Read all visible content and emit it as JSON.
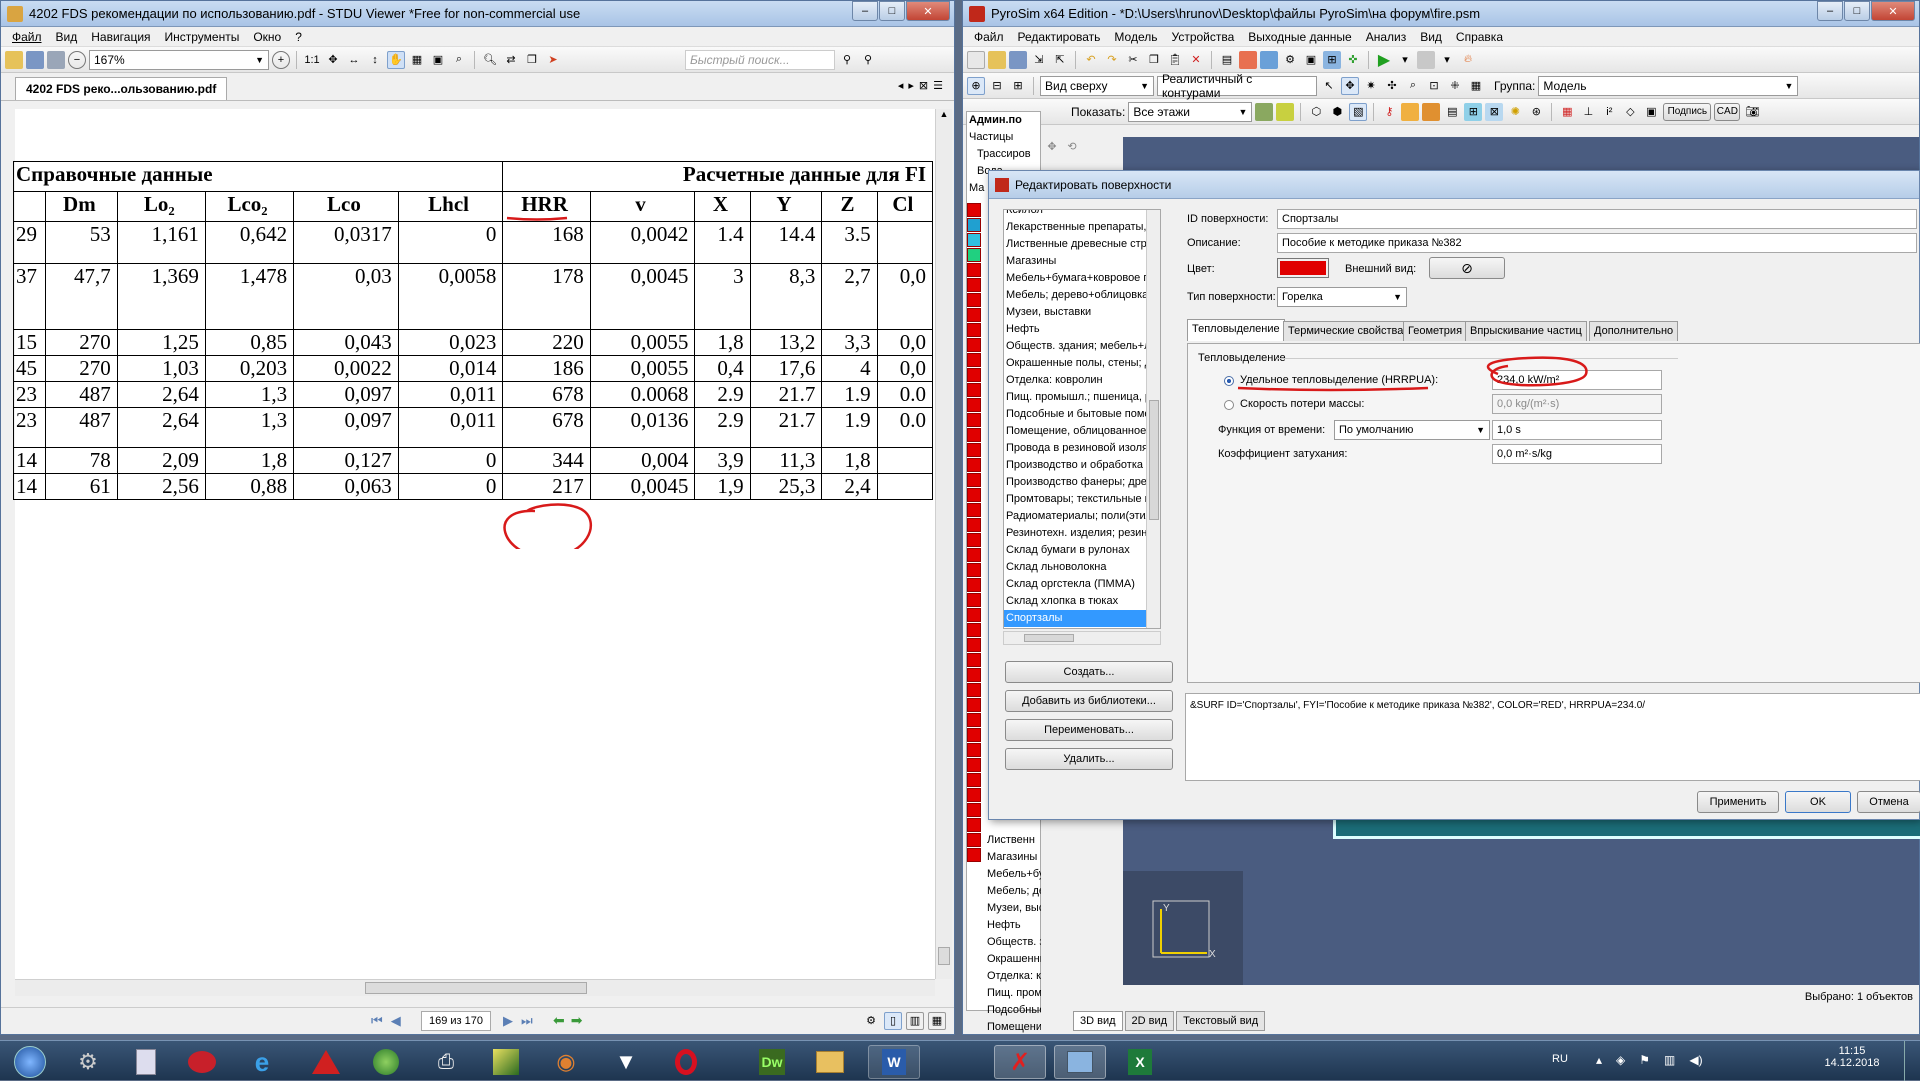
{
  "pdf": {
    "title": "4202 FDS рекомендации по использованию.pdf - STDU Viewer *Free for non-commercial use",
    "menu": [
      "Файл",
      "Вид",
      "Навигация",
      "Инструменты",
      "Окно",
      "?"
    ],
    "zoom": "167%",
    "search_placeholder": "Быстрый поиск...",
    "tab": "4202 FDS реко...ользованию.pdf",
    "page_indicator": "169 из 170",
    "table": {
      "header_left": "Справочные данные",
      "header_right": "Расчетные данные для FI",
      "columns": [
        "Dm",
        "Lo₂",
        "Lco₂",
        "Lco",
        "Lhcl",
        "HRR",
        "v",
        "X",
        "Y",
        "Z",
        "Cl"
      ],
      "rows": [
        [
          "29",
          "53",
          "1,161",
          "0,642",
          "0,0317",
          "0",
          "168",
          "0,0042",
          "1.4",
          "14.4",
          "3.5",
          ""
        ],
        [
          "37",
          "47,7",
          "1,369",
          "1,478",
          "0,03",
          "0,0058",
          "178",
          "0,0045",
          "3",
          "8,3",
          "2,7",
          "0,0"
        ],
        [
          "15",
          "270",
          "1,25",
          "0,85",
          "0,043",
          "0,023",
          "220",
          "0,0055",
          "1,8",
          "13,2",
          "3,3",
          "0,0"
        ],
        [
          "45",
          "270",
          "1,03",
          "0,203",
          "0,0022",
          "0,014",
          "186",
          "0,0055",
          "0,4",
          "17,6",
          "4",
          "0,0"
        ],
        [
          "23",
          "487",
          "2,64",
          "1,3",
          "0,097",
          "0,011",
          "678",
          "0.0068",
          "2.9",
          "21.7",
          "1.9",
          "0.0"
        ],
        [
          "23",
          "487",
          "2,64",
          "1,3",
          "0,097",
          "0,011",
          "678",
          "0,0136",
          "2.9",
          "21.7",
          "1.9",
          "0.0"
        ],
        [
          "14",
          "78",
          "2,09",
          "1,8",
          "0,127",
          "0",
          "344",
          "0,004",
          "3,9",
          "11,3",
          "1,8",
          ""
        ],
        [
          "14",
          "61",
          "2,56",
          "0,88",
          "0,063",
          "0",
          "217",
          "0,0045",
          "1,9",
          "25,3",
          "2,4",
          ""
        ]
      ]
    }
  },
  "pyro": {
    "title": "PyroSim x64 Edition - *D:\\Users\\hrunov\\Desktop\\файлы PyroSim\\на форум\\fire.psm",
    "menu": [
      "Файл",
      "Редактировать",
      "Модель",
      "Устройства",
      "Выходные данные",
      "Анализ",
      "Вид",
      "Справка"
    ],
    "view_combo": "Вид сверху",
    "render_combo": "Реалистичный с контурами",
    "group_label": "Группа:",
    "group_value": "Модель",
    "show_label": "Показать:",
    "show_value": "Все этажи",
    "btn_sign": "Подпись",
    "btn_cad": "CAD",
    "tree": [
      "Админ.по",
      "Частицы",
      "Трассиров",
      "Вода",
      "Ма"
    ],
    "lower_list": [
      "Лиственн",
      "Магазины",
      "Мебель+бу",
      "Мебель; де",
      "Музеи, выс",
      "Нефть",
      "Обществ. з",
      "Окрашенны",
      "Отделка: к",
      "Пищ. проми",
      "Подсобные",
      "Помещени"
    ],
    "bottom_tabs": [
      "3D вид",
      "2D вид",
      "Текстовый вид"
    ],
    "status": "Выбрано: 1 объектов"
  },
  "dialog": {
    "title": "Редактировать поверхности",
    "list": [
      "Ксилол",
      "Лекарственные препараты, с",
      "Лиственные древесные стро",
      "Магазины",
      "Мебель+бумага+ковровое по",
      "Мебель; дерево+облицовка",
      "Музеи, выставки",
      "Нефть",
      "Обществ. здания; мебель+ли",
      "Окрашенные полы, стены; де",
      "Отделка: ковролин",
      "Пищ. промышл.; пшеница, рис",
      "Подсобные и бытовые помещ",
      "Помещение, облицованное па",
      "Провода в резиновой изоляц",
      "Производство и обработка др",
      "Производство фанеры; древе",
      "Промтовары; текстильные из",
      "Радиоматериалы; поли(этиле",
      "Резинотехн. изделия; резина,",
      "Склад бумаги в рулонах",
      "Склад льноволокна",
      "Склад оргстекла (ПММА)",
      "Склад хлопка в тюках",
      "Спортзалы"
    ],
    "selected": "Спортзалы",
    "id_label": "ID поверхности:",
    "id_value": "Спортзалы",
    "desc_label": "Описание:",
    "desc_value": "Пособие к методике приказа №382",
    "color_label": "Цвет:",
    "color_value": "#e00000",
    "appearance_label": "Внешний вид:",
    "type_label": "Тип поверхности:",
    "type_value": "Горелка",
    "tabs": [
      "Тепловыделение",
      "Термические свойства",
      "Геометрия",
      "Впрыскивание частиц",
      "Дополнительно"
    ],
    "group_title": "Тепловыделение",
    "hrrpua_label": "Удельное тепловыделение (HRRPUA):",
    "hrrpua_value": "234,0 kW/m²",
    "mlr_label": "Скорость потери массы:",
    "mlr_value": "0,0 kg/(m²·s)",
    "ramp_label": "Функция от времени:",
    "ramp_value": "По умолчанию",
    "ramp_time": "1,0 s",
    "ext_label": "Коэффициент затухания:",
    "ext_value": "0,0 m²·s/kg",
    "fds_text": "&SURF ID='Спортзалы', FYI='Пособие к методике приказа №382', COLOR='RED', HRRPUA=234.0/",
    "btn_create": "Создать...",
    "btn_addlib": "Добавить из библиотеки...",
    "btn_rename": "Переименовать...",
    "btn_delete": "Удалить...",
    "btn_apply": "Применить",
    "btn_ok": "OK",
    "btn_cancel": "Отмена"
  },
  "taskbar": {
    "lang": "RU",
    "time": "11:15",
    "date": "14.12.2018"
  },
  "colors": {
    "annotation": "#d81a1a",
    "accent": "#3399ff"
  }
}
